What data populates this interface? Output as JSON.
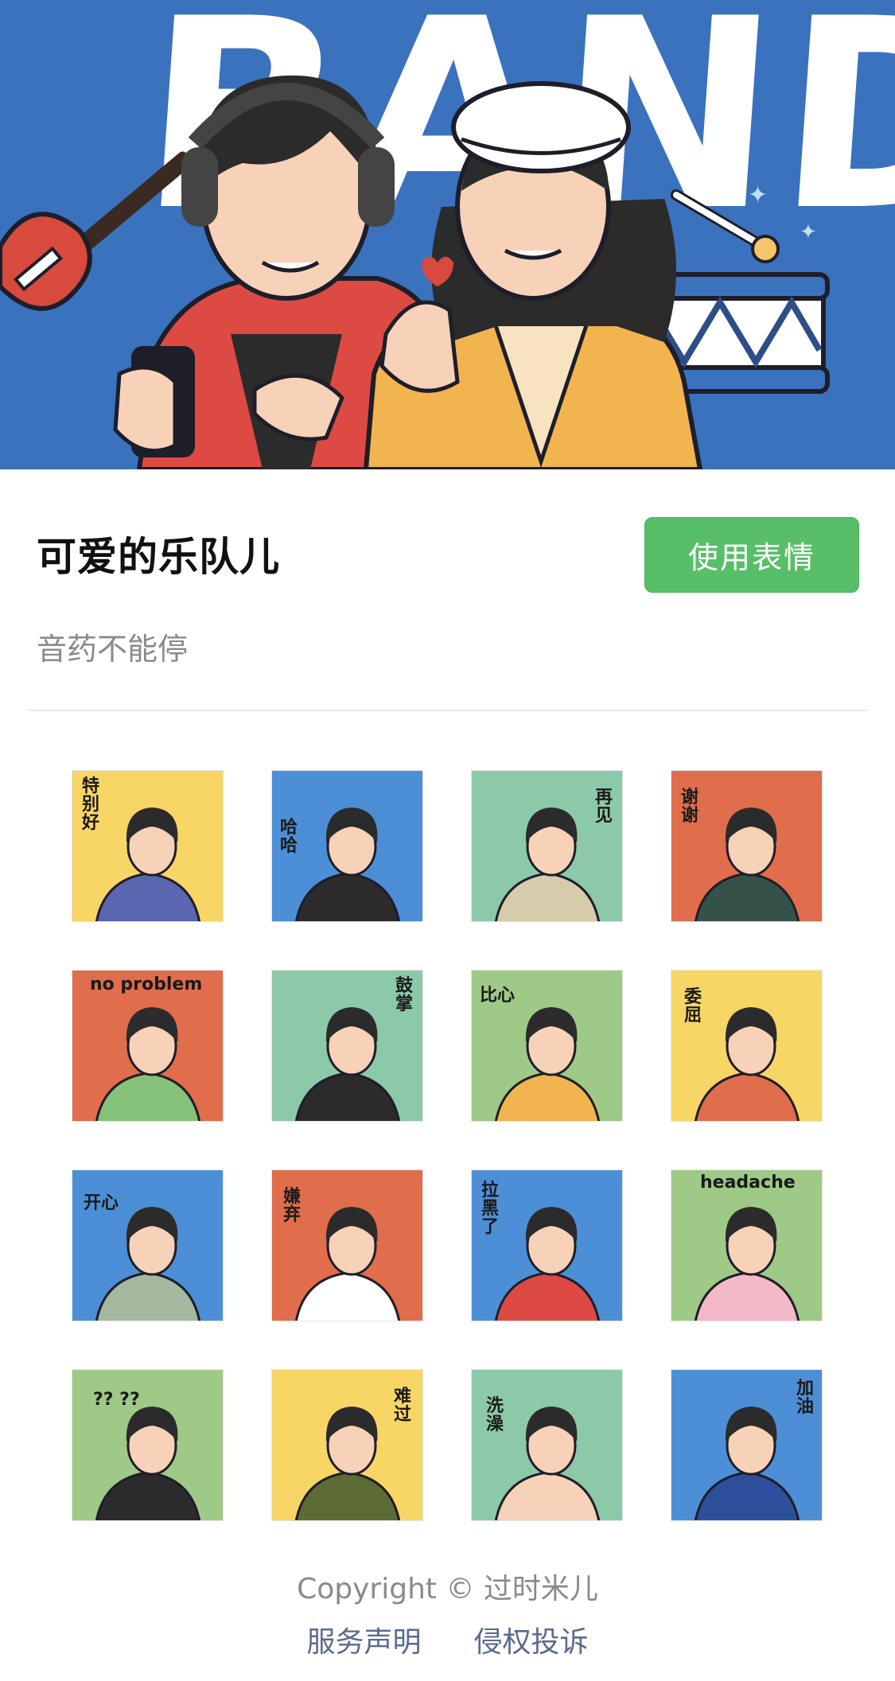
{
  "banner": {
    "word": "BAND",
    "background_color": "#3a72be"
  },
  "pack": {
    "title": "可爱的乐队儿",
    "subtitle": "音药不能停",
    "use_button_label": "使用表情",
    "accent_color": "#58bf68"
  },
  "stickers": [
    {
      "caption": "特\n别\n好",
      "bg": "#f8d665"
    },
    {
      "caption": "哈\n哈",
      "bg": "#4d8fd6"
    },
    {
      "caption": "再\n见",
      "bg": "#8cc9a8"
    },
    {
      "caption": "谢\n谢",
      "bg": "#e06d4b"
    },
    {
      "caption": "no problem",
      "bg": "#e06d4b"
    },
    {
      "caption": "鼓\n掌",
      "bg": "#8cc9a8"
    },
    {
      "caption": "比心",
      "bg": "#9fc986"
    },
    {
      "caption": "委\n屈",
      "bg": "#f8d665"
    },
    {
      "caption": "开心",
      "bg": "#4d8fd6"
    },
    {
      "caption": "嫌\n弃",
      "bg": "#e06d4b"
    },
    {
      "caption": "拉\n黑\n了",
      "bg": "#4d8fd6"
    },
    {
      "caption": "headache",
      "bg": "#9fc986"
    },
    {
      "caption": "??      ??",
      "bg": "#9fc986"
    },
    {
      "caption": "难\n过",
      "bg": "#f8d665"
    },
    {
      "caption": "洗\n澡",
      "bg": "#8cc9a8"
    },
    {
      "caption": "加\n油",
      "bg": "#4d8fd6"
    }
  ],
  "footer": {
    "copyright": "Copyright © 过时米儿",
    "service_link": "服务声明",
    "report_link": "侵权投诉"
  }
}
